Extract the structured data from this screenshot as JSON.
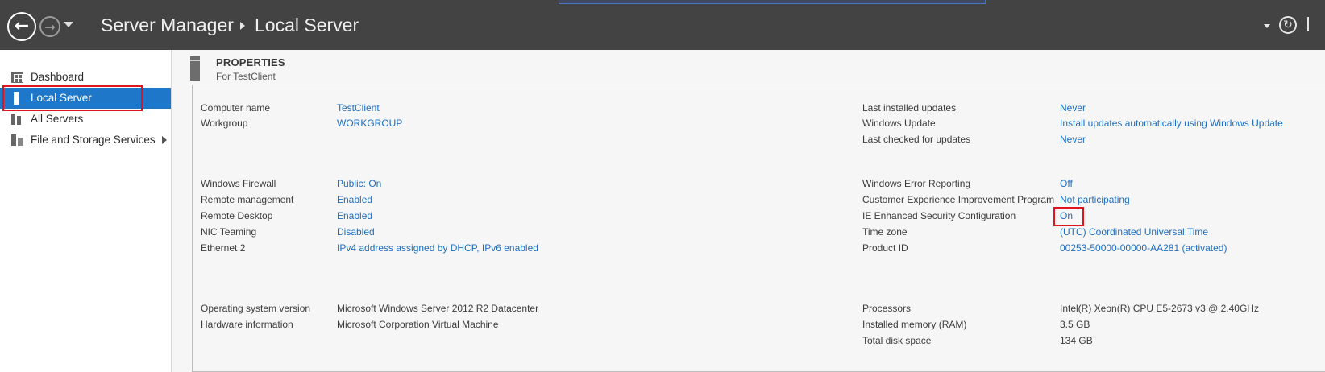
{
  "header": {
    "breadcrumb_root": "Server Manager",
    "breadcrumb_current": "Local Server"
  },
  "sidebar": {
    "items": [
      {
        "label": "Dashboard",
        "icon": "dashboard-icon"
      },
      {
        "label": "Local Server",
        "icon": "server-icon",
        "selected": true
      },
      {
        "label": "All Servers",
        "icon": "servers-icon"
      },
      {
        "label": "File and Storage Services",
        "icon": "storage-icon",
        "expandable": true
      }
    ]
  },
  "properties": {
    "title": "PROPERTIES",
    "subtitle": "For TestClient",
    "left": [
      {
        "label": "Computer name",
        "value": "TestClient",
        "link": true
      },
      {
        "label": "Workgroup",
        "value": "WORKGROUP",
        "link": true
      },
      {
        "label": "Windows Firewall",
        "value": "Public: On",
        "link": true
      },
      {
        "label": "Remote management",
        "value": "Enabled",
        "link": true
      },
      {
        "label": "Remote Desktop",
        "value": "Enabled",
        "link": true
      },
      {
        "label": "NIC Teaming",
        "value": "Disabled",
        "link": true
      },
      {
        "label": "Ethernet 2",
        "value": "IPv4 address assigned by DHCP, IPv6 enabled",
        "link": true
      },
      {
        "label": "Operating system version",
        "value": "Microsoft Windows Server 2012 R2 Datacenter",
        "link": false
      },
      {
        "label": "Hardware information",
        "value": "Microsoft Corporation Virtual Machine",
        "link": false
      }
    ],
    "right": [
      {
        "label": "Last installed updates",
        "value": "Never",
        "link": true
      },
      {
        "label": "Windows Update",
        "value": "Install updates automatically using Windows Update",
        "link": true
      },
      {
        "label": "Last checked for updates",
        "value": "Never",
        "link": true
      },
      {
        "label": "Windows Error Reporting",
        "value": "Off",
        "link": true
      },
      {
        "label": "Customer Experience Improvement Program",
        "value": "Not participating",
        "link": true
      },
      {
        "label": "IE Enhanced Security Configuration",
        "value": "On",
        "link": true
      },
      {
        "label": "Time zone",
        "value": "(UTC) Coordinated Universal Time",
        "link": true
      },
      {
        "label": "Product ID",
        "value": "00253-50000-00000-AA281 (activated)",
        "link": true
      },
      {
        "label": "Processors",
        "value": "Intel(R) Xeon(R) CPU E5-2673 v3 @ 2.40GHz",
        "link": false
      },
      {
        "label": "Installed memory (RAM)",
        "value": "3.5 GB",
        "link": false
      },
      {
        "label": "Total disk space",
        "value": "134 GB",
        "link": false
      }
    ]
  },
  "colors": {
    "header_bg": "#434343",
    "selection": "#1e77c8",
    "link": "#1e6ec0",
    "highlight_outline": "#e0141e"
  }
}
